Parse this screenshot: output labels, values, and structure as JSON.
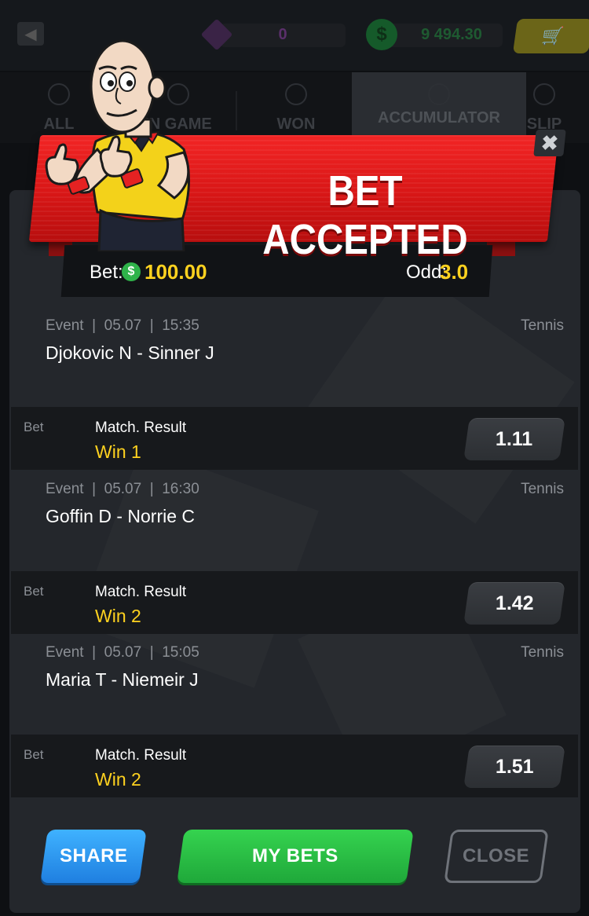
{
  "topbar": {
    "gems": "0",
    "balance": "9 494.30"
  },
  "tabs": [
    {
      "label": "ALL"
    },
    {
      "label": "IN GAME"
    },
    {
      "label": "WON"
    },
    {
      "label": "ACCUMULATOR"
    },
    {
      "label": "SLIP"
    }
  ],
  "modal": {
    "title": "BET ACCEPTED",
    "bet_label": "Bet:",
    "bet_amount": "100.00",
    "odd_label": "Odd:",
    "odd_value": "3.0",
    "close_symbol": "✖"
  },
  "events": [
    {
      "meta": "Event  |  05.07  |  15:35",
      "sport": "Tennis",
      "name": "Djokovic N - Sinner J",
      "bet_label": "Bet",
      "market": "Match. Result",
      "pick": "Win 1",
      "odd": "1.11"
    },
    {
      "meta": "Event  |  05.07  |  16:30",
      "sport": "Tennis",
      "name": "Goffin D - Norrie C",
      "bet_label": "Bet",
      "market": "Match. Result",
      "pick": "Win 2",
      "odd": "1.42"
    },
    {
      "meta": "Event  |  05.07  |  15:05",
      "sport": "Tennis",
      "name": "Maria T - Niemeir J",
      "bet_label": "Bet",
      "market": "Match. Result",
      "pick": "Win 2",
      "odd": "1.51"
    }
  ],
  "buttons": {
    "share": "SHARE",
    "my_bets": "MY BETS",
    "close": "CLOSE"
  },
  "colors": {
    "accent_yellow": "#ffd21f",
    "banner_red": "#d81616",
    "share_blue": "#1f7fe0",
    "mybets_green": "#1fa83a"
  }
}
